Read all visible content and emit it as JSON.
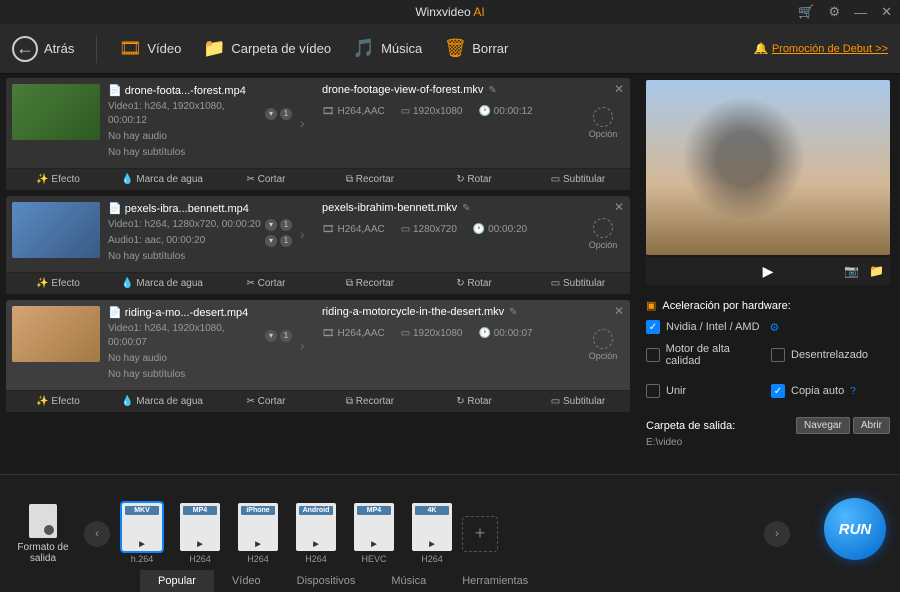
{
  "app": {
    "name": "Winxvideo",
    "suffix": "AI"
  },
  "toolbar": {
    "back": "Atrás",
    "video": "Vídeo",
    "folder": "Carpeta de vídeo",
    "music": "Música",
    "clear": "Borrar",
    "promo": "Promoción de Debut >>"
  },
  "files": [
    {
      "src_name": "drone-foota...-forest.mp4",
      "video_line": "Video1: h264, 1920x1080, 00:00:12",
      "audio_line": "No hay audio",
      "sub_line": "No hay subtítulos",
      "out_name": "drone-footage-view-of-forest.mkv",
      "codec": "H264,AAC",
      "res": "1920x1080",
      "dur": "00:00:12"
    },
    {
      "src_name": "pexels-ibra...bennett.mp4",
      "video_line": "Video1: h264, 1280x720, 00:00:20",
      "audio_line": "Audio1: aac, 00:00:20",
      "sub_line": "No hay subtítulos",
      "out_name": "pexels-ibrahim-bennett.mkv",
      "codec": "H264,AAC",
      "res": "1280x720",
      "dur": "00:00:20"
    },
    {
      "src_name": "riding-a-mo...-desert.mp4",
      "video_line": "Video1: h264, 1920x1080, 00:00:07",
      "audio_line": "No hay audio",
      "sub_line": "No hay subtítulos",
      "out_name": "riding-a-motorcycle-in-the-desert.mkv",
      "codec": "H264,AAC",
      "res": "1920x1080",
      "dur": "00:00:07"
    }
  ],
  "tool_labels": {
    "effect": "Efecto",
    "watermark": "Marca de agua",
    "cut": "Cortar",
    "crop": "Recortar",
    "rotate": "Rotar",
    "subtitle": "Subtitular"
  },
  "option_label": "Opción",
  "settings": {
    "hw_title": "Aceleración por hardware:",
    "hw_option": "Nvidia / Intel / AMD",
    "hq": "Motor de alta calidad",
    "deint": "Desentrelazado",
    "join": "Unir",
    "autocopy": "Copia auto",
    "folder_label": "Carpeta de salida:",
    "folder_path": "E:\\video",
    "browse": "Navegar",
    "open": "Abrir"
  },
  "output_fmt": {
    "label": "Formato de salida"
  },
  "presets": [
    {
      "top": "MKV",
      "bottom": "h.264"
    },
    {
      "top": "MP4",
      "bottom": "H264"
    },
    {
      "top": "iPhone",
      "bottom": "H264"
    },
    {
      "top": "Android",
      "bottom": "H264"
    },
    {
      "top": "MP4",
      "bottom": "HEVC"
    },
    {
      "top": "4K",
      "bottom": "H264"
    }
  ],
  "tabs": [
    "Popular",
    "Vídeo",
    "Dispositivos",
    "Música",
    "Herramientas"
  ],
  "run": "RUN"
}
